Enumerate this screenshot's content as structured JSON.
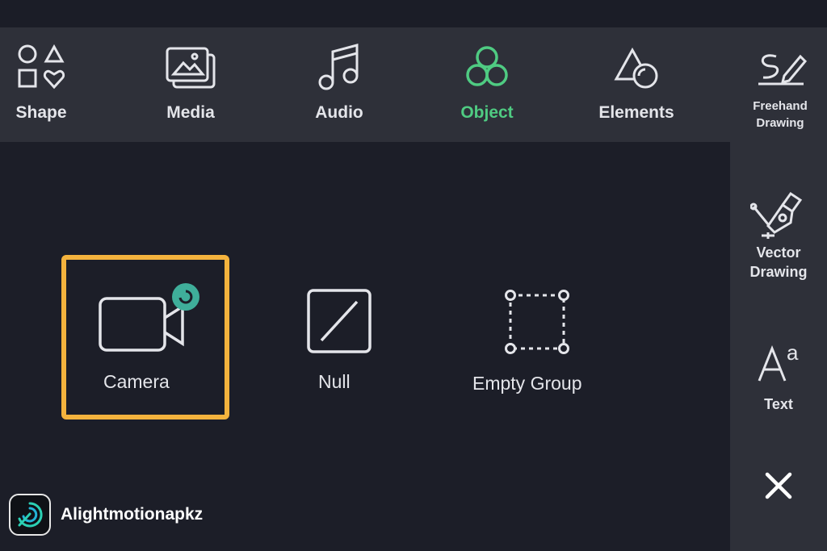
{
  "toolbar": {
    "items": [
      {
        "label": "Shape",
        "icon": "shape-icon"
      },
      {
        "label": "Media",
        "icon": "media-icon"
      },
      {
        "label": "Audio",
        "icon": "audio-icon"
      },
      {
        "label": "Object",
        "icon": "object-icon",
        "active": true
      },
      {
        "label": "Elements",
        "icon": "elements-icon"
      },
      {
        "label_line1": "Freehand",
        "label_line2": "Drawing",
        "icon": "freehand-drawing-icon"
      }
    ]
  },
  "sidebar": {
    "vector": {
      "label_line1": "Vector",
      "label_line2": "Drawing",
      "icon": "vector-pen-icon"
    },
    "text": {
      "label": "Text",
      "icon": "text-icon"
    },
    "close": {
      "icon": "close-icon"
    }
  },
  "objects": [
    {
      "label": "Camera",
      "icon": "camera-icon",
      "selected": true
    },
    {
      "label": "Null",
      "icon": "null-icon"
    },
    {
      "label": "Empty Group",
      "icon": "empty-group-icon"
    }
  ],
  "brand": {
    "name": "Alightmotionapkz",
    "icon": "alight-motion-logo"
  },
  "colors": {
    "accent_green": "#4fcb82",
    "selection_orange": "#f4b33d",
    "badge_teal": "#3fae9a",
    "panel_bg": "#2e3039",
    "main_bg": "#1c1e28"
  }
}
